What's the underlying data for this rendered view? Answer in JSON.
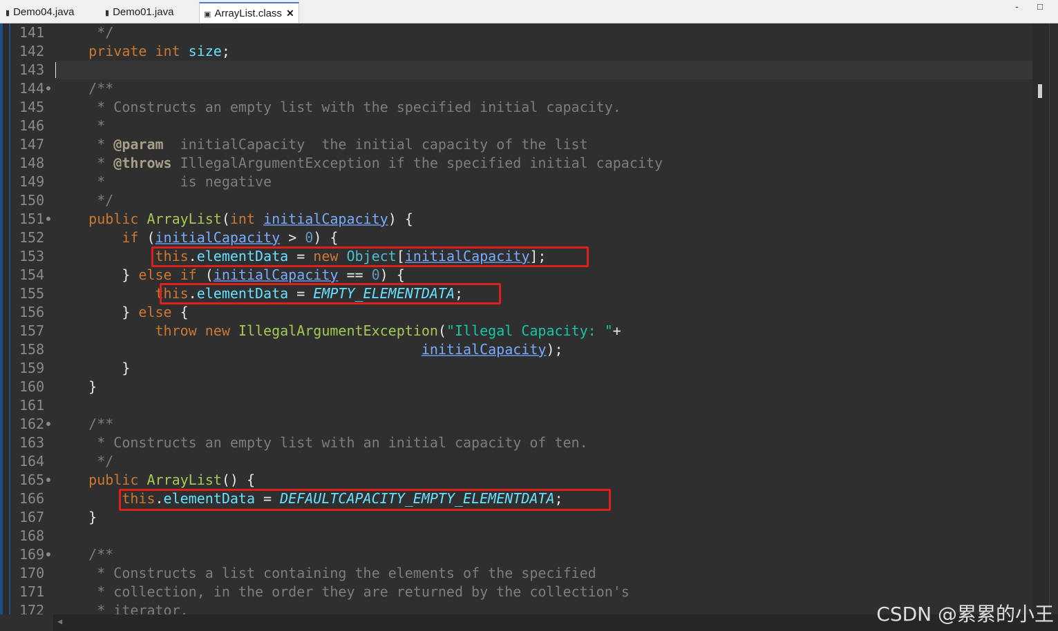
{
  "tabs": [
    {
      "label": "Demo04.java",
      "icon": "java-file-icon",
      "active": false
    },
    {
      "label": "Demo01.java",
      "icon": "java-file-icon",
      "active": false
    },
    {
      "label": "ArrayList.class",
      "icon": "class-file-icon",
      "active": true
    }
  ],
  "window_controls": "- □",
  "editor": {
    "line_numbers": [
      "141",
      "142",
      "143",
      "144",
      "145",
      "146",
      "147",
      "148",
      "149",
      "150",
      "151",
      "152",
      "153",
      "154",
      "155",
      "156",
      "157",
      "158",
      "159",
      "160",
      "161",
      "162",
      "163",
      "164",
      "165",
      "166",
      "167",
      "168",
      "169",
      "170",
      "171",
      "172"
    ],
    "code": {
      "l141": " */",
      "l142_kw": "private int",
      "l142_field": "size",
      "l142_end": ";",
      "l144": "/**",
      "l145": " * Constructs an empty list with the specified initial capacity.",
      "l146": " *",
      "l147_a": " * ",
      "l147_tag": "@param",
      "l147_b": "  initialCapacity  the initial capacity of the list",
      "l148_a": " * ",
      "l148_tag": "@throws",
      "l148_b": " IllegalArgumentException if the specified initial capacity",
      "l149": " *         is negative",
      "l150": " */",
      "l151_kw": "public",
      "l151_ctor": "ArrayList",
      "l151_p1": "(",
      "l151_kw2": "int",
      "l151_param": "initialCapacity",
      "l151_p2": ") {",
      "l152_kw": "if",
      "l152_p1": " (",
      "l152_param": "initialCapacity",
      "l152_op": " > ",
      "l152_num": "0",
      "l152_p2": ") {",
      "l153_kw": "this",
      "l153_dot": ".",
      "l153_field": "elementData",
      "l153_eq": " = ",
      "l153_new": "new",
      "l153_cls": "Object",
      "l153_b1": "[",
      "l153_param": "initialCapacity",
      "l153_b2": "];",
      "l154_p": "} ",
      "l154_kw": "else if",
      "l154_p1": " (",
      "l154_param": "initialCapacity",
      "l154_op": " == ",
      "l154_num": "0",
      "l154_p2": ") {",
      "l155_kw": "this",
      "l155_dot": ".",
      "l155_field": "elementData",
      "l155_eq": " = ",
      "l155_static": "EMPTY_ELEMENTDATA",
      "l155_end": ";",
      "l156_p": "} ",
      "l156_kw": "else",
      "l156_p2": " {",
      "l157_kw": "throw new",
      "l157_ctor": "IllegalArgumentException",
      "l157_p1": "(",
      "l157_str": "\"Illegal Capacity: \"",
      "l157_plus": "+",
      "l158_param": "initialCapacity",
      "l158_end": ");",
      "l159": "}",
      "l160": "}",
      "l162": "/**",
      "l163": " * Constructs an empty list with an initial capacity of ten.",
      "l164": " */",
      "l165_kw": "public",
      "l165_ctor": "ArrayList",
      "l165_p": "() {",
      "l166_kw": "this",
      "l166_dot": ".",
      "l166_field": "elementData",
      "l166_eq": " = ",
      "l166_static": "DEFAULTCAPACITY_EMPTY_ELEMENTDATA",
      "l166_end": ";",
      "l167": "}",
      "l169": "/**",
      "l170": " * Constructs a list containing the elements of the specified",
      "l171": " * collection, in the order they are returned by the collection's",
      "l172": " * iterator."
    }
  },
  "watermark": "CSDN @累累的小王",
  "colors": {
    "keyword": "#cc7832",
    "field": "#66e0ff",
    "constructor": "#a6c955",
    "comment": "#7d7d7d",
    "string": "#17c6a3",
    "highlight_box": "#e0201c"
  }
}
